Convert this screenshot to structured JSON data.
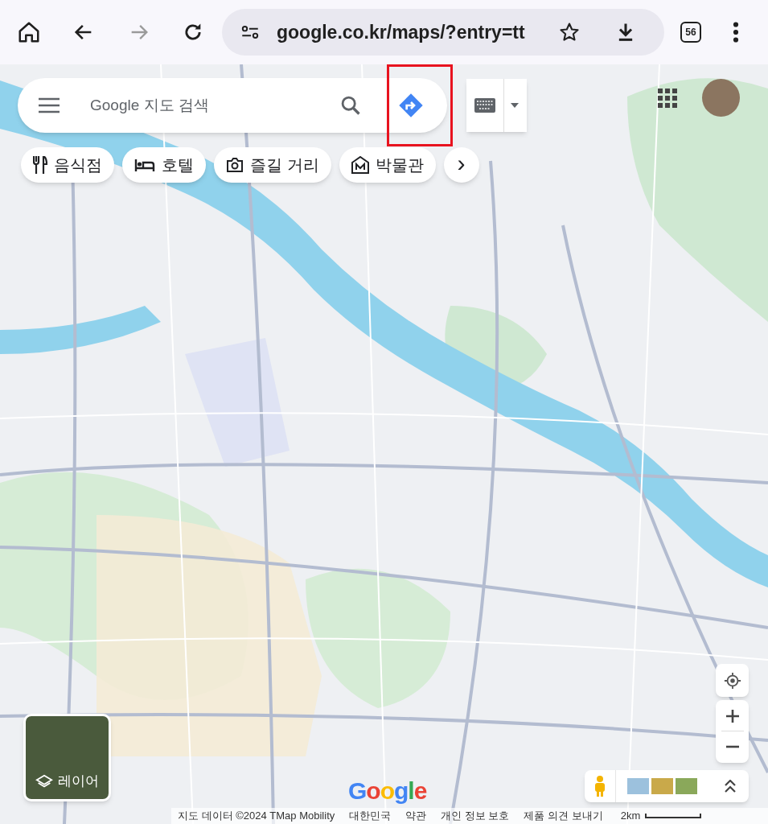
{
  "browser": {
    "url": "google.co.kr/maps/?entry=tt",
    "tab_count": "56"
  },
  "search": {
    "placeholder": "Google 지도 검색"
  },
  "chips": [
    {
      "kind": "restaurant",
      "label": "음식점"
    },
    {
      "kind": "hotel",
      "label": "호텔"
    },
    {
      "kind": "camera",
      "label": "즐길 거리"
    },
    {
      "kind": "museum",
      "label": "박물관"
    },
    {
      "kind": "more",
      "label": "›"
    }
  ],
  "layers_button": {
    "label": "레이어"
  },
  "logo": "Google",
  "attribution": [
    "지도 데이터 ©2024 TMap Mobility",
    "대한민국",
    "약관",
    "개인 정보 보호",
    "제품 의견 보내기"
  ],
  "scale": "2km"
}
